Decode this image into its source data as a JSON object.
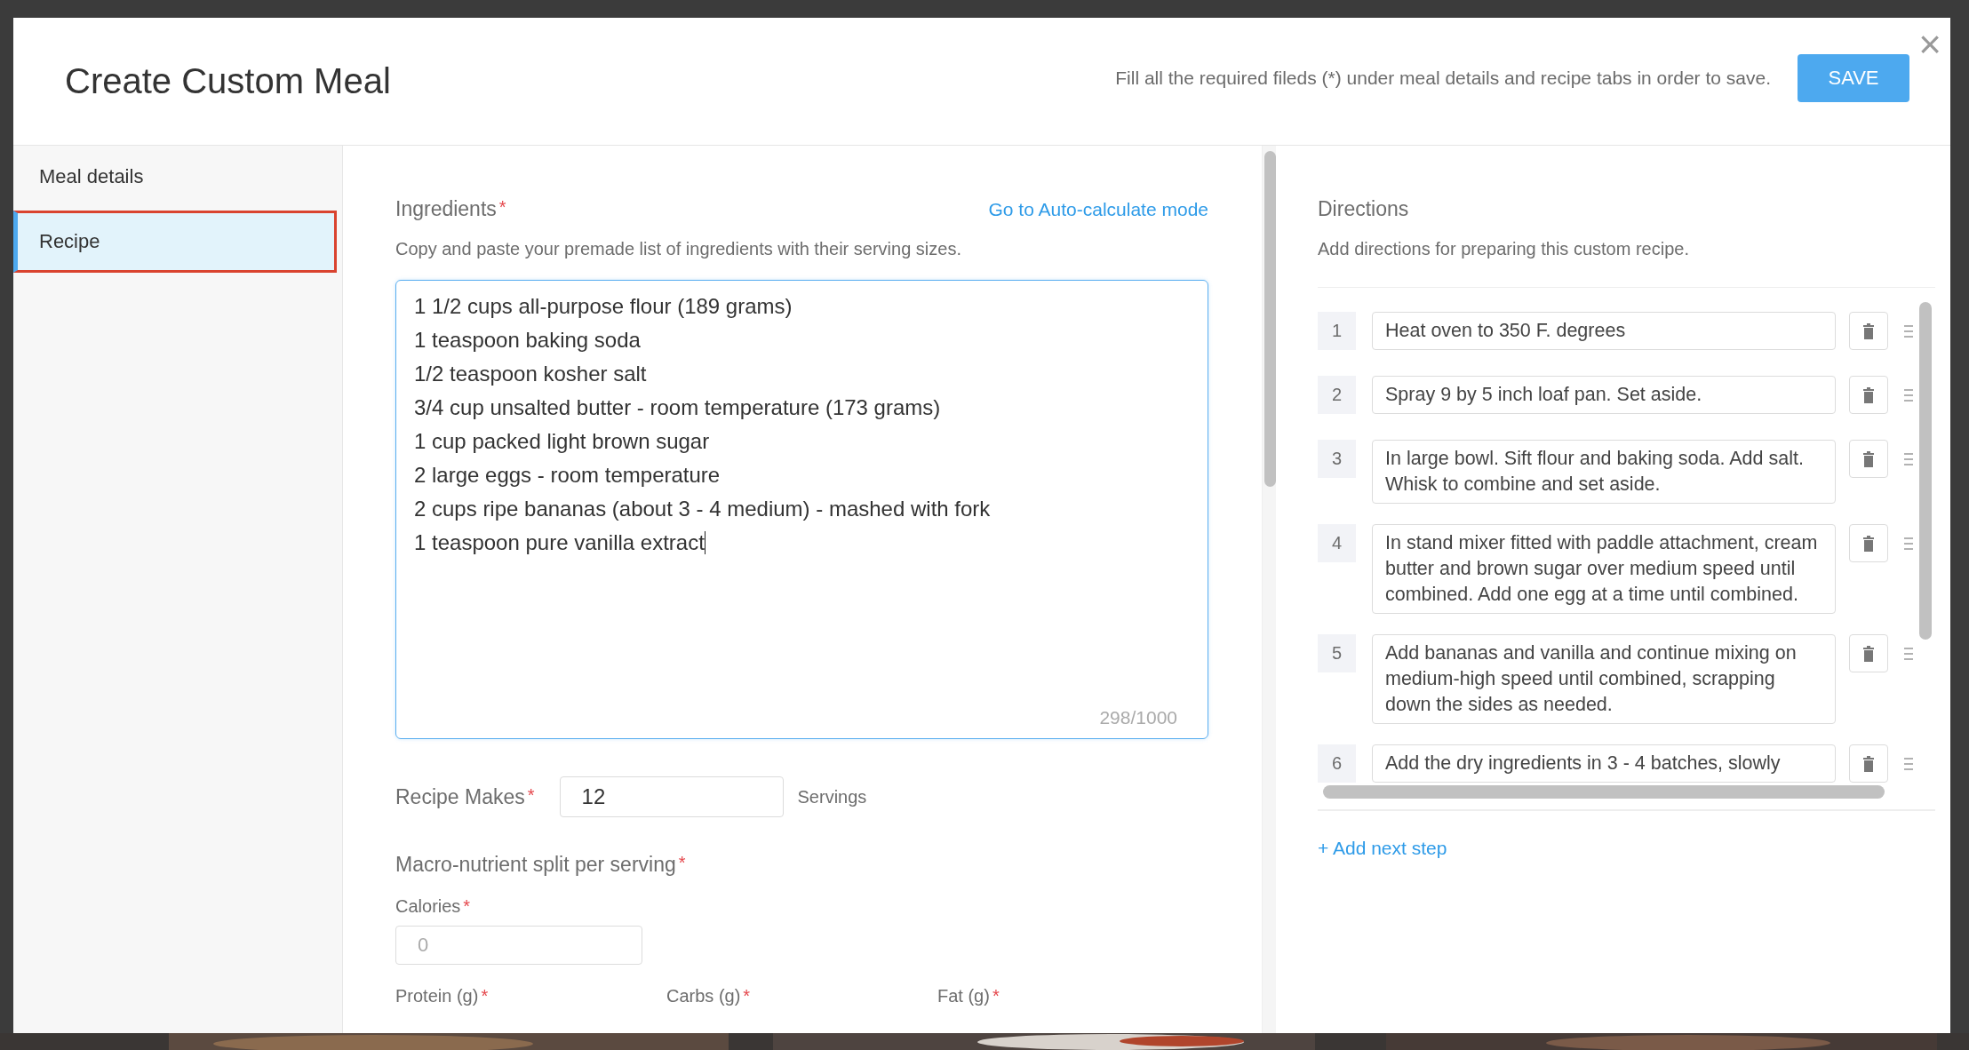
{
  "window": {
    "title": "Create Custom Meal",
    "notice": "Fill all the required fileds (*) under meal details and recipe tabs in order to save.",
    "save_label": "SAVE",
    "close_label": "×"
  },
  "sidebar": {
    "items": [
      {
        "label": "Meal details",
        "selected": false
      },
      {
        "label": "Recipe",
        "selected": true
      }
    ]
  },
  "ingredients": {
    "label": "Ingredients",
    "required_mark": "*",
    "link": "Go to Auto-calculate mode",
    "hint": "Copy and paste your premade list of ingredients with their serving sizes.",
    "focused": true,
    "value": "1 1/2 cups all-purpose flour (189 grams)\n1 teaspoon baking soda\n1/2 teaspoon kosher salt\n3/4 cup unsalted butter - room temperature (173 grams)\n1 cup packed light brown sugar\n2 large eggs - room temperature\n2 cups ripe bananas (about 3 - 4 medium) - mashed with fork\n1 teaspoon pure vanilla extract",
    "counter": "298/1000"
  },
  "recipe_makes": {
    "label": "Recipe Makes",
    "required_mark": "*",
    "value": "12",
    "unit": "Servings"
  },
  "macros": {
    "label": "Macro-nutrient split per serving",
    "required_mark": "*",
    "calories": {
      "label": "Calories",
      "required_mark": "*",
      "placeholder": "0"
    },
    "fields": [
      {
        "label": "Protein (g)",
        "required_mark": "*"
      },
      {
        "label": "Carbs (g)",
        "required_mark": "*"
      },
      {
        "label": "Fat (g)",
        "required_mark": "*"
      }
    ]
  },
  "directions": {
    "label": "Directions",
    "hint": "Add directions for preparing this custom recipe.",
    "add_link": "+ Add next step",
    "steps": [
      {
        "number": "1",
        "text": "Heat oven to 350 F. degrees"
      },
      {
        "number": "2",
        "text": "Spray 9 by 5 inch loaf pan. Set aside."
      },
      {
        "number": "3",
        "text": "In large bowl. Sift flour and baking soda. Add salt. Whisk to combine and set aside."
      },
      {
        "number": "4",
        "text": "In stand mixer fitted with paddle attachment, cream butter and brown sugar over medium speed until combined. Add one egg at a time until combined."
      },
      {
        "number": "5",
        "text": "Add bananas and vanilla and continue mixing on medium-high speed until combined, scrapping down the sides as needed."
      },
      {
        "number": "6",
        "text": "Add the dry ingredients in 3 - 4 batches, slowly"
      }
    ]
  }
}
